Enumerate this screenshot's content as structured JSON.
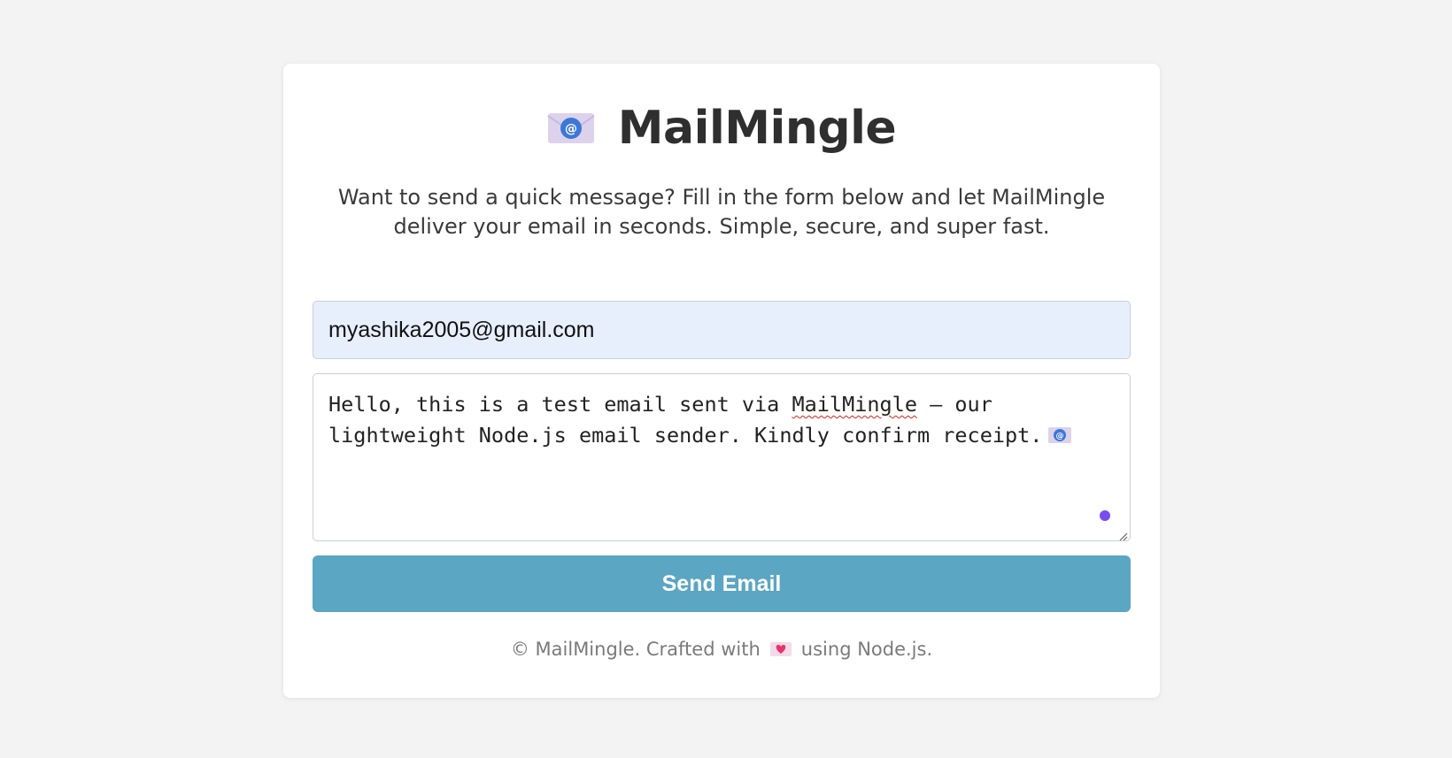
{
  "app": {
    "title": "MailMingle",
    "logo_icon": "envelope-at-icon"
  },
  "description": "Want to send a quick message? Fill in the form below and let MailMingle deliver your email in seconds. Simple, secure, and super fast.",
  "form": {
    "email_value": "myashika2005@gmail.com",
    "message_before": "Hello, this is a test email sent via ",
    "message_misspelled": "MailMingle",
    "message_after": " — our lightweight Node.js email sender. Kindly confirm receipt.",
    "message_icon": "envelope-at-icon",
    "send_label": "Send Email"
  },
  "footer": {
    "prefix": "© MailMingle. Crafted with",
    "heart_icon": "heart-letter-icon",
    "suffix": "using Node.js."
  },
  "colors": {
    "background": "#f3f3f3",
    "card": "#ffffff",
    "input_fill": "#e8effc",
    "button": "#5ba6c2",
    "grammar_dot": "#7a4df2"
  }
}
